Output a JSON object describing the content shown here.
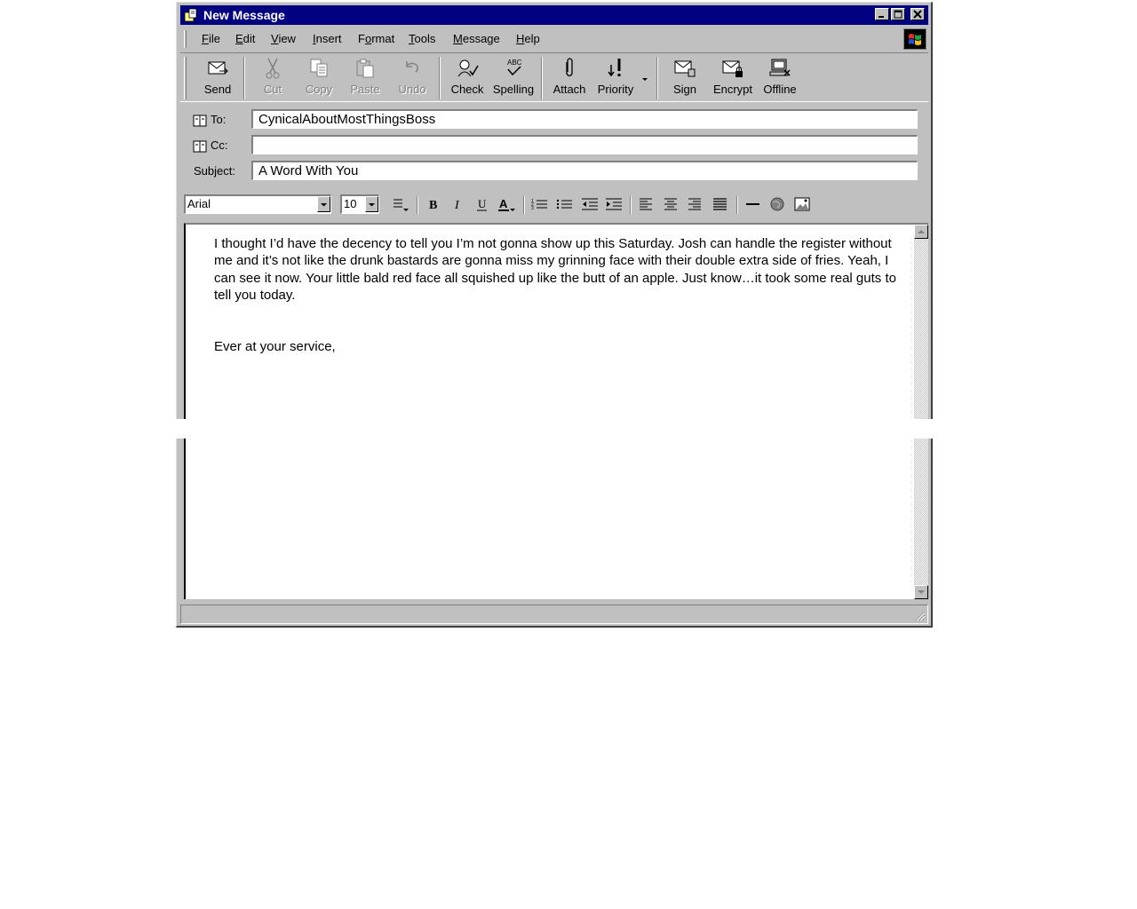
{
  "window": {
    "title": "New Message"
  },
  "menu": [
    "File",
    "Edit",
    "View",
    "Insert",
    "Format",
    "Tools",
    "Message",
    "Help"
  ],
  "menu_mnemonics": [
    "F",
    "E",
    "V",
    "I",
    "o",
    "T",
    "M",
    "H"
  ],
  "toolbar": {
    "send": "Send",
    "cut": "Cut",
    "copy": "Copy",
    "paste": "Paste",
    "undo": "Undo",
    "check": "Check",
    "spelling": "Spelling",
    "attach": "Attach",
    "priority": "Priority",
    "sign": "Sign",
    "encrypt": "Encrypt",
    "offline": "Offline"
  },
  "fields": {
    "to_label": "To:",
    "to_value": "CynicalAboutMostThingsBoss",
    "cc_label": "Cc:",
    "cc_value": "",
    "subject_label": "Subject:",
    "subject_value": "A Word With You"
  },
  "format": {
    "font": "Arial",
    "size": "10"
  },
  "message": {
    "paragraph": "I thought I’d have the decency to tell you I’m not gonna show up this Saturday. Josh can handle the register without me and it’s not like the drunk bastards are gonna miss my grinning face with their double extra side of fries. Yeah, I can see it now. Your little bald red face all squished up like the butt of an apple. Just know…it took some real guts to tell you today.",
    "signoff": "Ever at your service,"
  }
}
